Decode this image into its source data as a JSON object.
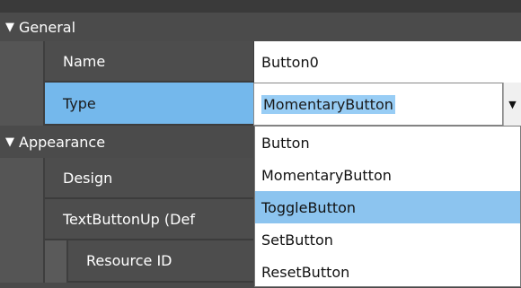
{
  "sections": {
    "general": "General",
    "appearance": "Appearance"
  },
  "section_arrow": "▼",
  "properties": {
    "name": {
      "label": "Name",
      "value": "Button0"
    },
    "type": {
      "label": "Type",
      "value": "MomentaryButton"
    },
    "design": {
      "label": "Design"
    },
    "text_button_up": {
      "label": "TextButtonUp (Def"
    },
    "resource_id": {
      "label": "Resource ID"
    }
  },
  "dropdown": {
    "arrow_icon": "caret-down-icon",
    "options": [
      "Button",
      "MomentaryButton",
      "ToggleButton",
      "SetButton",
      "ResetButton"
    ],
    "highlighted": "ToggleButton"
  },
  "colors": {
    "selected_row": "#74b8ec",
    "highlighted_option": "#8cc4ef",
    "panel_dark": "#4b4b4b"
  }
}
